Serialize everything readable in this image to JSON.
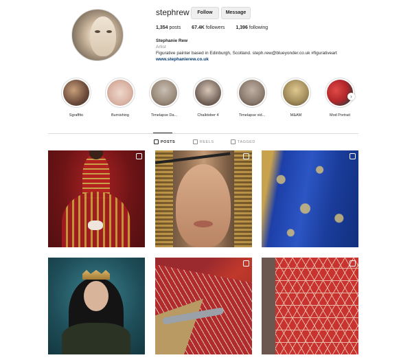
{
  "profile": {
    "username": "stephrew",
    "follow_label": "Follow",
    "message_label": "Message",
    "stats": {
      "posts_value": "1,354",
      "posts_label": "posts",
      "followers_value": "67.4K",
      "followers_label": "followers",
      "following_value": "1,396",
      "following_label": "following"
    },
    "bio": {
      "name": "Stephanie Rew",
      "category": "Artist",
      "text": "Figurative painter based in Edinburgh, Scotland. steph.rew@blueyonder.co.uk #figurativeart",
      "link": "www.stephanierew.co.uk"
    }
  },
  "highlights": [
    {
      "label": "Sgraffito",
      "color": "#6b4a3a"
    },
    {
      "label": "Burnishing",
      "color": "#d9b2a3"
    },
    {
      "label": "Timelapse Da...",
      "color": "#9a8a7a"
    },
    {
      "label": "Chalktober 4",
      "color": "#7a6a60"
    },
    {
      "label": "Timelapse vid...",
      "color": "#8b7b6e"
    },
    {
      "label": "M&AM",
      "color": "#a08a5a"
    },
    {
      "label": "Mod Portrait",
      "color": "#b0262a"
    }
  ],
  "tabs": [
    {
      "label": "POSTS",
      "active": true
    },
    {
      "label": "REELS",
      "active": false
    },
    {
      "label": "TAGGED",
      "active": false
    }
  ]
}
